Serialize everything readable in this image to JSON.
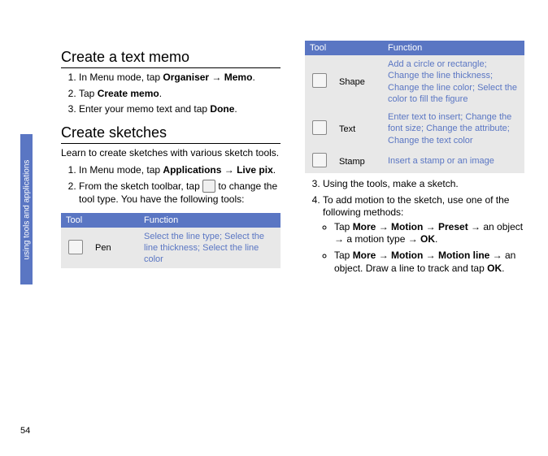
{
  "page_number": "54",
  "side_tab": "using tools and applications",
  "section_memo": {
    "heading": "Create a text memo",
    "steps": [
      {
        "pre": "In Menu mode, tap ",
        "bold": "Organiser → Memo",
        "post": "."
      },
      {
        "pre": "Tap ",
        "bold": "Create memo",
        "post": "."
      },
      {
        "pre": "Enter your memo text and tap ",
        "bold": "Done",
        "post": "."
      }
    ]
  },
  "section_sketch": {
    "heading": "Create sketches",
    "intro": "Learn to create sketches with various sketch tools.",
    "step1": {
      "pre": "In Menu mode, tap ",
      "bold": "Applications → Live pix",
      "post": "."
    },
    "step2_a": "From the sketch toolbar, tap ",
    "step2_b": " to change the tool type. You have the following tools:",
    "table_header": {
      "c1": "Tool",
      "c2": "Function"
    },
    "tools": {
      "pen": {
        "name": "Pen",
        "func": "Select the line type; Select the line thickness; Select the line color"
      },
      "shape": {
        "name": "Shape",
        "func": "Add a circle or rectangle; Change the line thickness; Change the line color; Select the color to fill the figure"
      },
      "text": {
        "name": "Text",
        "func": "Enter text to insert; Change the font size; Change the attribute; Change the text color"
      },
      "stamp": {
        "name": "Stamp",
        "func": "Insert a stamp or an image"
      }
    },
    "step3": "Using the tools, make a sketch.",
    "step4": "To add motion to the sketch, use one of the following methods:",
    "bullet1_a": "Tap ",
    "bullet1_b": "More → Motion → Preset",
    "bullet1_c": " → an object → a motion type → ",
    "bullet1_d": "OK",
    "bullet1_e": ".",
    "bullet2_a": "Tap ",
    "bullet2_b": "More → Motion → Motion line",
    "bullet2_c": " → an object. Draw a line to track and tap ",
    "bullet2_d": "OK",
    "bullet2_e": "."
  }
}
